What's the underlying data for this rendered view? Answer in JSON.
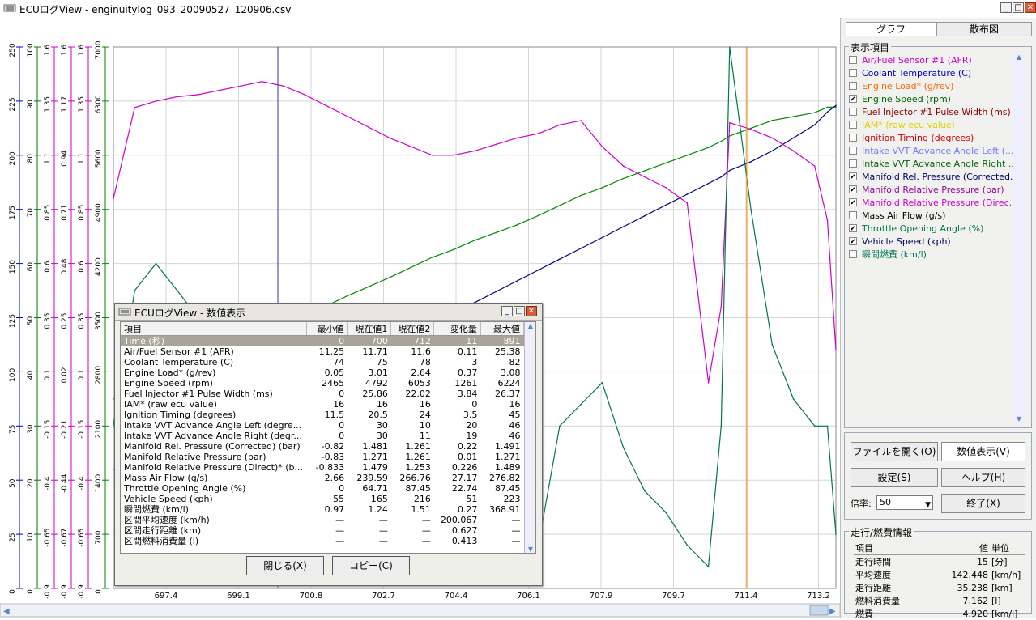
{
  "window": {
    "title": "ECUログView - enginuitylog_093_20090527_120906.csv"
  },
  "colors": {
    "afr": "#cc00cc",
    "coolant": "#0000ee",
    "load": "#ff6600",
    "rpm": "#008800",
    "injector": "#880000",
    "iam": "#eeee00",
    "timing": "#cc0000",
    "vvt_l": "#7777ff",
    "vvt_r": "#006600",
    "mrp": "#990099",
    "maf": "#000000",
    "throttle": "#007744",
    "speed": "#000088"
  },
  "axes": {
    "columns": [
      {
        "color": "#0000cc",
        "ticks": [
          "250",
          "225",
          "200",
          "175",
          "150",
          "125",
          "100",
          "75",
          "50",
          "25",
          "0"
        ]
      },
      {
        "color": "#007700",
        "ticks": [
          "100",
          "90",
          "80",
          "70",
          "60",
          "50",
          "40",
          "30",
          "20",
          "10",
          "0"
        ]
      },
      {
        "color": "#cc00cc",
        "ticks": [
          "1.6",
          "1.35",
          "1.1",
          "0.85",
          "0.6",
          "0.35",
          "0.1",
          "-0.15",
          "-0.4",
          "-0.65",
          "-0.9"
        ]
      },
      {
        "color": "#cc00cc",
        "ticks": [
          "1.6",
          "1.17",
          "0.94",
          "0.71",
          "0.48",
          "0.25",
          "0.02",
          "-0.21",
          "-0.44",
          "-0.67",
          "-0.9"
        ]
      },
      {
        "color": "#cc00cc",
        "ticks": [
          "1.6",
          "1.35",
          "1.1",
          "0.85",
          "0.6",
          "0.35",
          "0.1",
          "-0.15",
          "-0.4",
          "-0.65",
          "-0.9"
        ]
      },
      {
        "color": "#008800",
        "ticks": [
          "7000",
          "6300",
          "5600",
          "4900",
          "4200",
          "3500",
          "2800",
          "2100",
          "1400",
          "700",
          "0"
        ]
      }
    ],
    "x_ticks": [
      "697.4",
      "699.1",
      "700.8",
      "702.7",
      "704.4",
      "706.1",
      "707.9",
      "709.7",
      "711.4",
      "713.2"
    ]
  },
  "chart_data": {
    "type": "line",
    "x": [
      696.5,
      697.0,
      697.5,
      698.0,
      698.5,
      699.0,
      699.5,
      700.0,
      700.5,
      701.0,
      701.5,
      702.0,
      702.5,
      703.0,
      703.5,
      704.0,
      704.5,
      705.0,
      705.5,
      706.0,
      706.5,
      707.0,
      707.5,
      708.0,
      708.5,
      709.0,
      709.5,
      710.0,
      710.5,
      710.8,
      711.0,
      711.5,
      712.0,
      712.5,
      713.0,
      713.3,
      713.5
    ],
    "xlim": [
      696.5,
      713.5
    ],
    "ylim": [
      0,
      7000
    ],
    "series": [
      {
        "name": "Engine Speed (rpm)",
        "color": "#008800",
        "values": [
          2450,
          2520,
          2600,
          2800,
          2950,
          3080,
          3200,
          3300,
          3420,
          3550,
          3650,
          3780,
          3900,
          4020,
          4150,
          4280,
          4380,
          4500,
          4600,
          4700,
          4820,
          4950,
          5080,
          5180,
          5300,
          5400,
          5500,
          5600,
          5700,
          5780,
          5850,
          5950,
          6050,
          6100,
          6150,
          6220,
          6224
        ]
      },
      {
        "name": "Vehicle Speed (kph)",
        "color": "#000088",
        "values": [
          55,
          58,
          60,
          65,
          70,
          75,
          80,
          85,
          90,
          95,
          100,
          105,
          110,
          115,
          120,
          125,
          128,
          132,
          137,
          142,
          147,
          152,
          157,
          162,
          167,
          172,
          177,
          182,
          187,
          190,
          193,
          197,
          202,
          208,
          214,
          220,
          223
        ]
      },
      {
        "name": "Manifold Rel. Pressure (Corrected) (bar)",
        "color": "#cc00cc",
        "values": [
          0.9,
          1.32,
          1.35,
          1.37,
          1.38,
          1.4,
          1.42,
          1.44,
          1.42,
          1.38,
          1.33,
          1.28,
          1.23,
          1.18,
          1.14,
          1.1,
          1.1,
          1.12,
          1.15,
          1.18,
          1.2,
          1.24,
          1.26,
          1.14,
          1.05,
          1.0,
          0.95,
          0.88,
          0.05,
          0.4,
          1.25,
          1.22,
          1.18,
          1.12,
          1.05,
          0.8,
          0.2
        ]
      },
      {
        "name": "Throttle Opening Angle (%)",
        "color": "#007744",
        "values": [
          30,
          55,
          60,
          55,
          50,
          44,
          38,
          30,
          24,
          20,
          16,
          14,
          12,
          10,
          8,
          7,
          6,
          5,
          5,
          6,
          8,
          30,
          34,
          38,
          26,
          18,
          14,
          8,
          4,
          30,
          100,
          70,
          45,
          35,
          30,
          30,
          10
        ]
      }
    ]
  },
  "right_panel": {
    "tab_graph": "グラフ",
    "tab_scatter": "散布図",
    "group_label": "表示項目",
    "items": [
      {
        "label": "Air/Fuel Sensor #1 (AFR)",
        "checked": "",
        "color": "#cc00cc"
      },
      {
        "label": "Coolant Temperature (C)",
        "checked": "",
        "color": "#0000cc"
      },
      {
        "label": "Engine Load* (g/rev)",
        "checked": "",
        "color": "#ff6600"
      },
      {
        "label": "Engine Speed (rpm)",
        "checked": "✔",
        "color": "#006600"
      },
      {
        "label": "Fuel Injector #1 Pulse Width (ms)",
        "checked": "",
        "color": "#880000"
      },
      {
        "label": "IAM* (raw ecu value)",
        "checked": "",
        "color": "#e0d000"
      },
      {
        "label": "Ignition Timing (degrees)",
        "checked": "",
        "color": "#cc0000"
      },
      {
        "label": "Intake VVT Advance Angle Left (...",
        "checked": "",
        "color": "#7777ff"
      },
      {
        "label": "Intake VVT Advance Angle Right ...",
        "checked": "",
        "color": "#006600"
      },
      {
        "label": "Manifold Rel. Pressure (Corrected...",
        "checked": "✔",
        "color": "#000066"
      },
      {
        "label": "Manifold Relative Pressure (bar)",
        "checked": "✔",
        "color": "#990099"
      },
      {
        "label": "Manifold Relative Pressure (Direc...",
        "checked": "✔",
        "color": "#cc00cc"
      },
      {
        "label": "Mass Air Flow (g/s)",
        "checked": "",
        "color": "#000000"
      },
      {
        "label": "Throttle Opening Angle (%)",
        "checked": "✔",
        "color": "#007744"
      },
      {
        "label": "Vehicle Speed (kph)",
        "checked": "✔",
        "color": "#000066"
      },
      {
        "label": "瞬間燃費 (km/l)",
        "checked": "",
        "color": "#007755"
      }
    ],
    "buttons": {
      "open": "ファイルを開く(O)",
      "values": "数値表示(V)",
      "settings": "設定(S)",
      "help": "ヘルプ(H)",
      "exit": "終了(X)"
    },
    "zoom_label": "倍率:",
    "zoom_value": "50",
    "fuel_group_label": "走行/燃費情報",
    "fuel_table": {
      "headers": [
        "項目",
        "値",
        "単位"
      ],
      "rows": [
        [
          "走行時間",
          "15",
          "[分]"
        ],
        [
          "平均速度",
          "142.448",
          "[km/h]"
        ],
        [
          "走行距離",
          "35.238",
          "[km]"
        ],
        [
          "燃料消費量",
          "7.162",
          "[l]"
        ],
        [
          "燃費",
          "4.920",
          "[km/l]"
        ]
      ]
    }
  },
  "dialog": {
    "title": "ECUログView - 数値表示",
    "headers": [
      "項目",
      "最小値",
      "現在値1",
      "現在値2",
      "変化量",
      "最大値"
    ],
    "rows": [
      [
        "Time (秒)",
        "0",
        "700",
        "712",
        "11",
        "891"
      ],
      [
        "Air/Fuel Sensor #1 (AFR)",
        "11.25",
        "11.71",
        "11.6",
        "0.11",
        "25.38"
      ],
      [
        "Coolant Temperature (C)",
        "74",
        "75",
        "78",
        "3",
        "82"
      ],
      [
        "Engine Load* (g/rev)",
        "0.05",
        "3.01",
        "2.64",
        "0.37",
        "3.08"
      ],
      [
        "Engine Speed (rpm)",
        "2465",
        "4792",
        "6053",
        "1261",
        "6224"
      ],
      [
        "Fuel Injector #1 Pulse Width (ms)",
        "0",
        "25.86",
        "22.02",
        "3.84",
        "26.37"
      ],
      [
        "IAM* (raw ecu value)",
        "16",
        "16",
        "16",
        "0",
        "16"
      ],
      [
        "Ignition Timing (degrees)",
        "11.5",
        "20.5",
        "24",
        "3.5",
        "45"
      ],
      [
        "Intake VVT Advance Angle Left (degre...",
        "0",
        "30",
        "10",
        "20",
        "46"
      ],
      [
        "Intake VVT Advance Angle Right (degr...",
        "0",
        "30",
        "11",
        "19",
        "46"
      ],
      [
        "Manifold Rel. Pressure (Corrected) (bar)",
        "-0.82",
        "1.481",
        "1.261",
        "0.22",
        "1.491"
      ],
      [
        "Manifold Relative Pressure (bar)",
        "-0.83",
        "1.271",
        "1.261",
        "0.01",
        "1.271"
      ],
      [
        "Manifold Relative Pressure (Direct)* (b...",
        "-0.833",
        "1.479",
        "1.253",
        "0.226",
        "1.489"
      ],
      [
        "Mass Air Flow (g/s)",
        "2.66",
        "239.59",
        "266.76",
        "27.17",
        "276.82"
      ],
      [
        "Throttle Opening Angle (%)",
        "0",
        "64.71",
        "87.45",
        "22.74",
        "87.45"
      ],
      [
        "Vehicle Speed (kph)",
        "55",
        "165",
        "216",
        "51",
        "223"
      ],
      [
        "瞬間燃費 (km/l)",
        "0.97",
        "1.24",
        "1.51",
        "0.27",
        "368.91"
      ],
      [
        "区間平均速度 (km/h)",
        "—",
        "—",
        "—",
        "200.067",
        "—"
      ],
      [
        "区間走行距離 (km)",
        "—",
        "—",
        "—",
        "0.627",
        "—"
      ],
      [
        "区間燃料消費量 (l)",
        "—",
        "—",
        "—",
        "0.413",
        "—"
      ]
    ],
    "close_label": "閉じる(X)",
    "copy_label": "コピー(C)"
  }
}
